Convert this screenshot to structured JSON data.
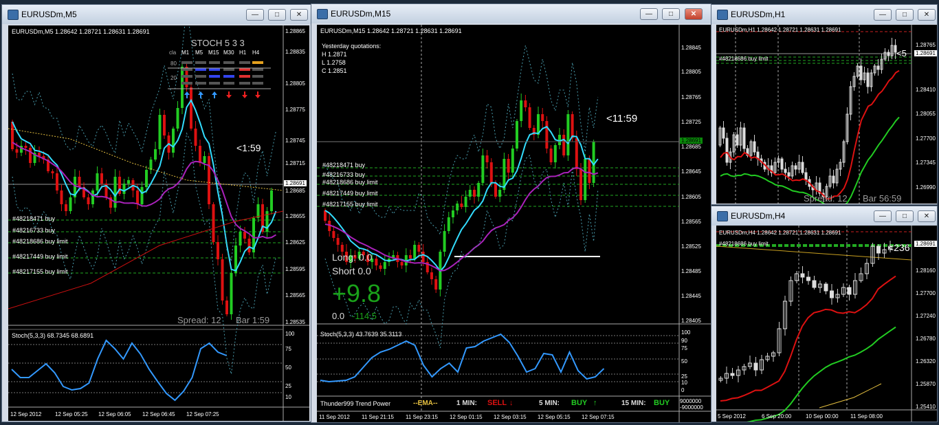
{
  "colors": {
    "bull": "#22cc22",
    "bear": "#dd1111",
    "ema_fast": "#33ddff",
    "ema_slow": "#aa22bb",
    "grid": "#777777",
    "buy_line": "#22aa22",
    "stoch": "#3399ff"
  },
  "windows": {
    "m5": {
      "title": "EURUSDm,M5",
      "header": "EURUSDm,M5  1.28642 1.28721 1.28631 1.28691",
      "prices": [
        "1.28865",
        "1.28835",
        "1.28805",
        "1.28775",
        "1.28745",
        "1.28715",
        "1.28685",
        "1.28655",
        "1.28625",
        "1.28595",
        "1.28565",
        "1.28535"
      ],
      "current_price": "1.28691",
      "timer": "<1:59",
      "spread": "Spread: 12",
      "bar": "Bar  1:59",
      "orders": [
        "#48218471 buy",
        "#48216733 buy",
        "#48218686 buy limit",
        "#48217449 buy limit",
        "#48217155 buy limit"
      ],
      "stoch_header": "Stoch(5,3,3) 68.7345 68.6891",
      "stoch_scale": [
        "100",
        "75",
        "50",
        "25",
        "10"
      ],
      "times": [
        "12 Sep 2012",
        "12 Sep 05:25",
        "12 Sep 06:05",
        "12 Sep 06:45",
        "12 Sep 07:25"
      ],
      "stoch_panel": {
        "title": "STOCH  5 3 3",
        "label": "cla",
        "cols": [
          "M1",
          "M5",
          "M15",
          "M30",
          "H1",
          "H4"
        ],
        "rows": [
          "80",
          "20"
        ]
      }
    },
    "m15": {
      "title": "EURUSDm,M15",
      "header": "EURUSDm,M15  1.28642 1.28721 1.28631 1.28691",
      "quotes": [
        "Yesterday quotations:",
        "H 1.2871",
        "L 1.2758",
        "C 1.2851"
      ],
      "prices": [
        "1.28845",
        "1.28805",
        "1.28765",
        "1.28725",
        "1.28685",
        "1.28645",
        "1.28605",
        "1.28565",
        "1.28525",
        "1.28485",
        "1.28445",
        "1.28405"
      ],
      "current_price": "1.28691",
      "timer": "<11:59",
      "long": "Long:  0.0",
      "short": "Short  0.0",
      "profit": "+9.8",
      "sub_left": "0.0",
      "sub_right": "-114.5",
      "orders": [
        "#48218471 buy",
        "#48216733 buy",
        "#48218686 buy limit",
        "#48217449 buy limit",
        "#48217155 buy limit"
      ],
      "stoch_header": "Stoch(5,3,3) 43.7639 35.3113",
      "stoch_scale": [
        "100",
        "90",
        "75",
        "50",
        "25",
        "10",
        "0"
      ],
      "trend": {
        "name": "Thunder999 Trend Power",
        "ema": "--EMA--",
        "m1_label": "1 MIN:",
        "m1_val": "SELL",
        "m5_label": "5 MIN:",
        "m5_val": "BUY",
        "m15_label": "15 MIN:",
        "m15_val": "BUY"
      },
      "trend_scale": [
        "9000000",
        "-9000000"
      ],
      "times": [
        "11 Sep 2012",
        "11 Sep 21:15",
        "11 Sep 23:15",
        "12 Sep 01:15",
        "12 Sep 03:15",
        "12 Sep 05:15",
        "12 Sep 07:15"
      ]
    },
    "h1": {
      "title": "EURUSDm,H1",
      "header": "EURUSDm,H1  1.28642 1.28721 1.28631 1.28691",
      "prices": [
        "1.28765",
        "1.28691",
        "1.28410",
        "1.28055",
        "1.27700",
        "1.27345",
        "1.26990"
      ],
      "current_price": "1.28691",
      "timer": "<5",
      "order": "#48218686 buy limit",
      "spread": "Spread: 12",
      "bar": "Bar  56:59"
    },
    "h4": {
      "title": "EURUSDm,H4",
      "header": "EURUSDm,H4  1.28642 1.28721 1.28631 1.28691",
      "prices": [
        "1.28691",
        "1.28160",
        "1.27700",
        "1.27240",
        "1.26780",
        "1.26320",
        "1.25870",
        "1.25410"
      ],
      "current_price": "1.28691",
      "timer": "<236",
      "order": "#48218686 buy limit",
      "times": [
        "5 Sep 2012",
        "6 Sep 20:00",
        "10 Sep 00:00",
        "11 Sep 08:00"
      ]
    }
  }
}
